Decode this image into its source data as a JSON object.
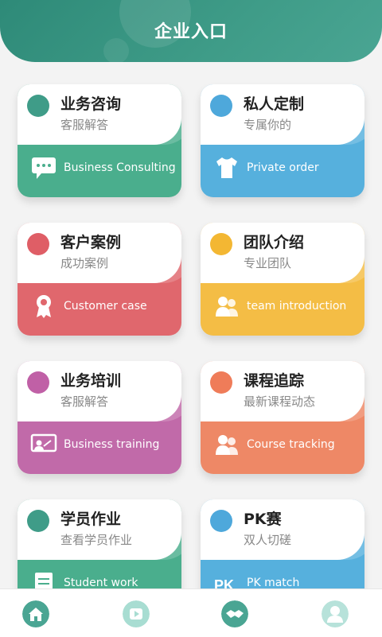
{
  "header": {
    "title": "企业入口"
  },
  "cards": [
    {
      "title": "业务咨询",
      "subtitle": "客服解答",
      "label": "Business Consulting",
      "icon": "chat-icon",
      "color": "#4aae8d",
      "dot": "#3f9c88"
    },
    {
      "title": "私人定制",
      "subtitle": "专属你的",
      "label": "Private order",
      "icon": "shirt-icon",
      "color": "#56b0dd",
      "dot": "#4ea8db"
    },
    {
      "title": "客户案例",
      "subtitle": "成功案例",
      "label": "Customer case",
      "icon": "award-icon",
      "color": "#e0676d",
      "dot": "#df5e66"
    },
    {
      "title": "团队介绍",
      "subtitle": "专业团队",
      "label": "team introduction",
      "icon": "team-icon",
      "color": "#f4bd45",
      "dot": "#f3b733"
    },
    {
      "title": "业务培训",
      "subtitle": "客服解答",
      "label": "Business training",
      "icon": "training-icon",
      "color": "#c16aa9",
      "dot": "#c060a6"
    },
    {
      "title": "课程追踪",
      "subtitle": "最新课程动态",
      "label": "Course tracking",
      "icon": "tracking-icon",
      "color": "#ee8866",
      "dot": "#ef7c59"
    },
    {
      "title": "学员作业",
      "subtitle": "查看学员作业",
      "label": "Student work",
      "icon": "document-icon",
      "color": "#4aae8d",
      "dot": "#3f9c88"
    },
    {
      "title": "PK赛",
      "subtitle": "双人切磋",
      "label": "PK match",
      "icon": "pk-icon",
      "color": "#56b0dd",
      "dot": "#4ea8db"
    }
  ],
  "nav": [
    {
      "icon": "home-icon",
      "color": "#4aa593"
    },
    {
      "icon": "video-icon",
      "color": "#8fd0c4"
    },
    {
      "icon": "handshake-icon",
      "color": "#4aa593"
    },
    {
      "icon": "profile-icon",
      "color": "#9bd6cb"
    }
  ]
}
